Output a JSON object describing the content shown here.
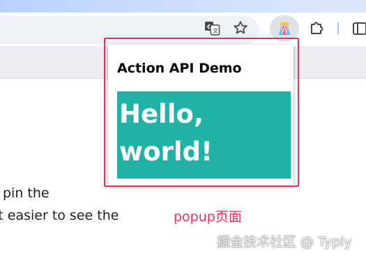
{
  "browser": {
    "toolbar": {
      "translate_icon": "translate-icon",
      "bookmark_icon": "star-icon",
      "extension_icon": "extension-avatar-icon",
      "extensions_menu_icon": "puzzle-icon",
      "side_panel_icon": "side-panel-icon"
    }
  },
  "page": {
    "line1": "pin the",
    "line2": "it easier to see the"
  },
  "popup": {
    "title": "Action API Demo",
    "hello_text": "Hello, world!",
    "hello_bg": "#20b2a5"
  },
  "annotation": {
    "label": "popup页面",
    "color": "#e0325c"
  },
  "watermark": {
    "text": "掘金技术社区 @ Typly"
  }
}
